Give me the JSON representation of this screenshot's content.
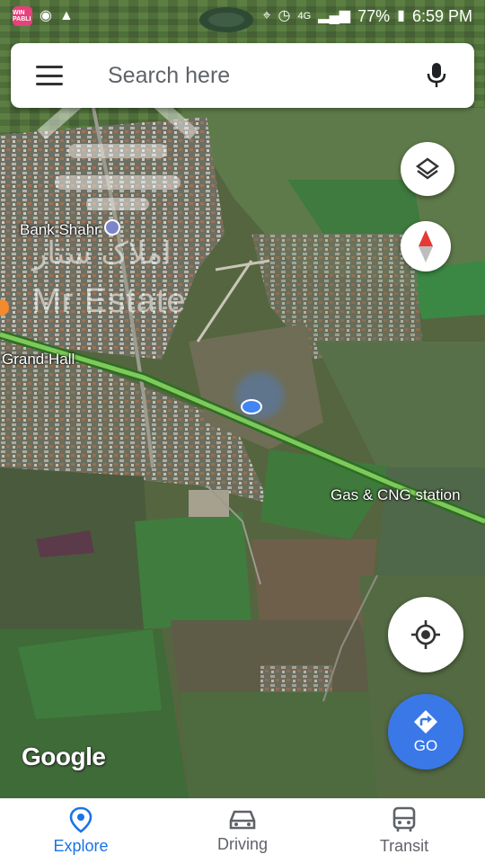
{
  "status_bar": {
    "app_badge": "WIN PABLI",
    "battery": "77%",
    "time": "6:59 PM",
    "network": "4G"
  },
  "search": {
    "placeholder": "Search here"
  },
  "map": {
    "labels": {
      "bank_shahr": "Bank Shahr",
      "grand_hall": "Grand Hall",
      "gas_station": "Gas & CNG station"
    },
    "attribution": "Google"
  },
  "watermark": {
    "persian": "املاک ستار",
    "english": "Mr Estate"
  },
  "fab": {
    "go_label": "GO"
  },
  "bottom_nav": {
    "items": [
      {
        "label": "Explore",
        "icon": "location-pin-icon",
        "active": true
      },
      {
        "label": "Driving",
        "icon": "car-icon",
        "active": false
      },
      {
        "label": "Transit",
        "icon": "bus-icon",
        "active": false
      }
    ]
  },
  "colors": {
    "accent": "#1a73e8",
    "go_button": "#3b78e7",
    "highway": "#7ec95a",
    "compass_red": "#e53935"
  }
}
